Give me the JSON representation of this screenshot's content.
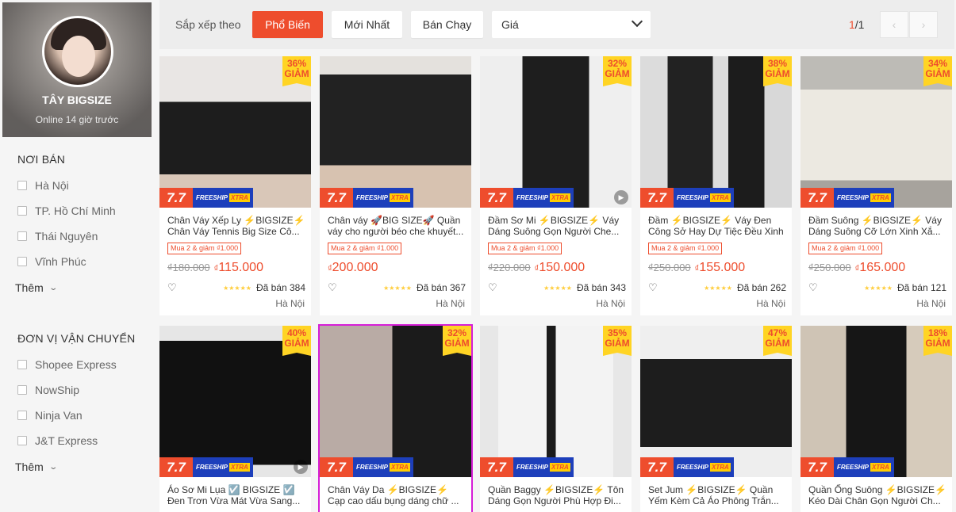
{
  "shop": {
    "name": "TÂY BIGSIZE",
    "online": "Online 14 giờ trước"
  },
  "filters": {
    "location": {
      "title": "NƠI BÁN",
      "items": [
        "Hà Nội",
        "TP. Hồ Chí Minh",
        "Thái Nguyên",
        "Vĩnh Phúc"
      ],
      "more": "Thêm"
    },
    "shipping": {
      "title": "ĐƠN VỊ VẬN CHUYỂN",
      "items": [
        "Shopee Express",
        "NowShip",
        "Ninja Van",
        "J&T Express"
      ],
      "more": "Thêm"
    }
  },
  "sort": {
    "label": "Sắp xếp theo",
    "options": [
      "Phổ Biến",
      "Mới Nhất",
      "Bán Chạy"
    ],
    "active": "Phổ Biến",
    "price": "Giá",
    "page_current": "1",
    "page_total": "/1"
  },
  "badge": {
    "sale": "7.7",
    "freeship": "FREESHIP",
    "xtra": "XTRA",
    "discount_word": "GIẢM",
    "currency": "₫"
  },
  "products": [
    {
      "name": "Chân Váy Xếp Ly ⚡BIGSIZE⚡ Chân Váy Tennis Big Size Cô...",
      "promo": "Mua 2 & giảm ₫1.000",
      "old_price": "₫180.000",
      "price": "115.000",
      "discount": "36%",
      "sold": "Đã bán 384",
      "location": "Hà Nội"
    },
    {
      "name": "Chân váy 🚀BIG SIZE🚀 Quần váy cho người béo che khuyết...",
      "promo": "Mua 2 & giảm ₫1.000",
      "old_price": "",
      "price": "200.000",
      "discount": "",
      "sold": "Đã bán 367",
      "location": "Hà Nội"
    },
    {
      "name": "Đầm Sơ Mi ⚡BIGSIZE⚡ Váy Dáng Suông Gọn Người Che...",
      "promo": "Mua 2 & giảm ₫1.000",
      "old_price": "₫220.000",
      "price": "150.000",
      "discount": "32%",
      "sold": "Đã bán 343",
      "location": "Hà Nội"
    },
    {
      "name": "Đầm ⚡BIGSIZE⚡ Váy Đen Công Sở Hay Dự Tiệc Đều Xinh",
      "promo": "Mua 2 & giảm ₫1.000",
      "old_price": "₫250.000",
      "price": "155.000",
      "discount": "38%",
      "sold": "Đã bán 262",
      "location": "Hà Nội"
    },
    {
      "name": "Đầm Suông ⚡BIGSIZE⚡ Váy Dáng Suông Cỡ Lớn Xinh Xắ...",
      "promo": "Mua 2 & giảm ₫1.000",
      "old_price": "₫250.000",
      "price": "165.000",
      "discount": "34%",
      "sold": "Đã bán 121",
      "location": "Hà Nội"
    },
    {
      "name": "Áo Sơ Mi Lụa ☑️ BIGSIZE ☑️ Đen Trơn Vừa Mát Vừa Sang...",
      "discount": "40%"
    },
    {
      "name": "Chân Váy Da ⚡BIGSIZE⚡ Cạp cao dấu bụng dáng chữ ...",
      "discount": "32%"
    },
    {
      "name": "Quần Baggy ⚡BIGSIZE⚡ Tôn Dáng Gọn Người Phù Hợp Đi...",
      "discount": "35%"
    },
    {
      "name": "Set Jum ⚡BIGSIZE⚡ Quần Yếm Kèm Cả Áo Phông Trắn...",
      "discount": "47%"
    },
    {
      "name": "Quần Ống Suông ⚡BIGSIZE⚡ Kéo Dài Chân Gọn Người Ch...",
      "discount": "18%"
    }
  ]
}
